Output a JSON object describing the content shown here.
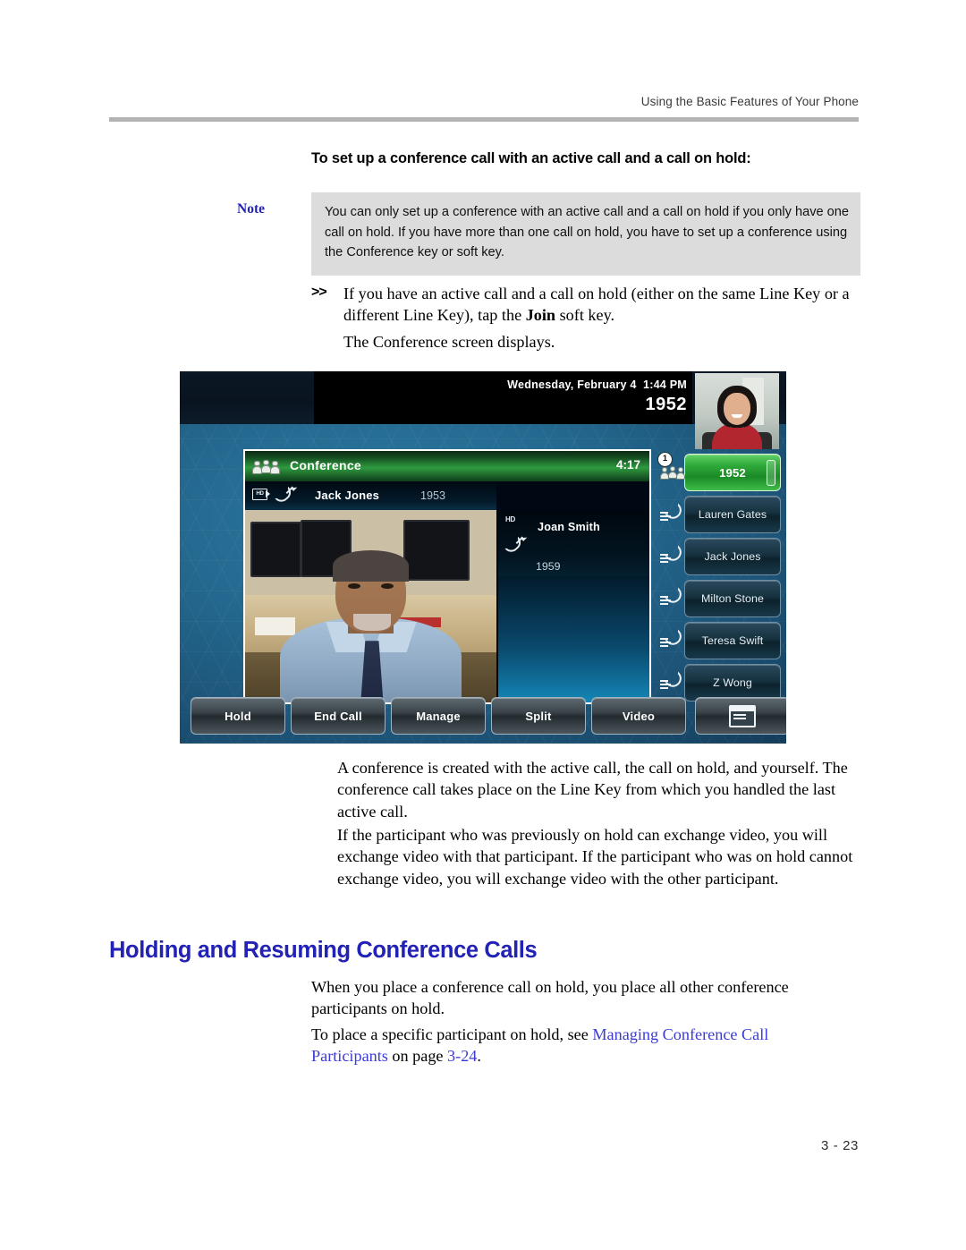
{
  "page": {
    "running_header": "Using the Basic Features of Your Phone",
    "page_number": "3 - 23"
  },
  "procedure": {
    "heading": "To set up a conference call with an active call and a call on hold:",
    "note_label": "Note",
    "note_text": "You can only set up a conference with an active call and a call on hold if you only have one call on hold. If you have more than one call on hold, you have to set up a conference using the Conference key or soft key.",
    "step_marker": ">>",
    "step_text_before": "If you have an active call and a call on hold (either on the same Line Key or a different Line Key), tap the ",
    "step_bold": "Join",
    "step_text_after": " soft key.",
    "step_result": "The Conference screen displays."
  },
  "after_image": {
    "para_a": "A conference is created with the active call, the call on hold, and yourself. The conference call takes place on the Line Key from which you handled the last active call.",
    "para_b": "If the participant who was previously on hold can exchange video, you will exchange video with that participant. If the participant who was on hold cannot exchange video, you will exchange video with the other participant."
  },
  "section": {
    "heading": "Holding and Resuming Conference Calls",
    "para_c": "When you place a conference call on hold, you place all other conference participants on hold.",
    "para_d_before": "To place a specific participant on hold, see ",
    "para_d_link": "Managing Conference Call Participants",
    "para_d_mid": " on page ",
    "para_d_pagelink": "3-24",
    "para_d_end": "."
  },
  "phone_screen": {
    "status_date": "Wednesday, February 4",
    "status_time": "1:44 PM",
    "status_extension": "1952",
    "conference": {
      "title": "Conference",
      "timer": "4:17",
      "icon": "conference-icon"
    },
    "active_party": {
      "name": "Jack Jones",
      "extension": "1953",
      "hd_badge": "HD",
      "call_icon": "outgoing-call-icon"
    },
    "held_party": {
      "name": "Joan Smith",
      "extension": "1959",
      "hd_badge": "HD",
      "call_icon": "outgoing-call-icon"
    },
    "line_keys": [
      {
        "label": "1952",
        "active": true,
        "badge": "1",
        "icon": "conference-icon"
      },
      {
        "label": "Lauren Gates",
        "active": false,
        "icon": "line-key-icon"
      },
      {
        "label": "Jack Jones",
        "active": false,
        "icon": "line-key-icon"
      },
      {
        "label": "Milton Stone",
        "active": false,
        "icon": "line-key-icon"
      },
      {
        "label": "Teresa Swift",
        "active": false,
        "icon": "line-key-icon"
      },
      {
        "label": "Z Wong",
        "active": false,
        "icon": "line-key-icon"
      }
    ],
    "soft_keys": [
      {
        "label": "Hold"
      },
      {
        "label": "End Call"
      },
      {
        "label": "Manage"
      },
      {
        "label": "Split"
      },
      {
        "label": "Video"
      },
      {
        "label": "",
        "icon": "window-list-icon"
      }
    ]
  },
  "colors": {
    "heading_blue": "#2222b5",
    "link_blue": "#3b3bd4",
    "note_background": "#dcdcdc",
    "rule_gray": "#b3b3b3",
    "active_key_green": "#2faa3a"
  }
}
